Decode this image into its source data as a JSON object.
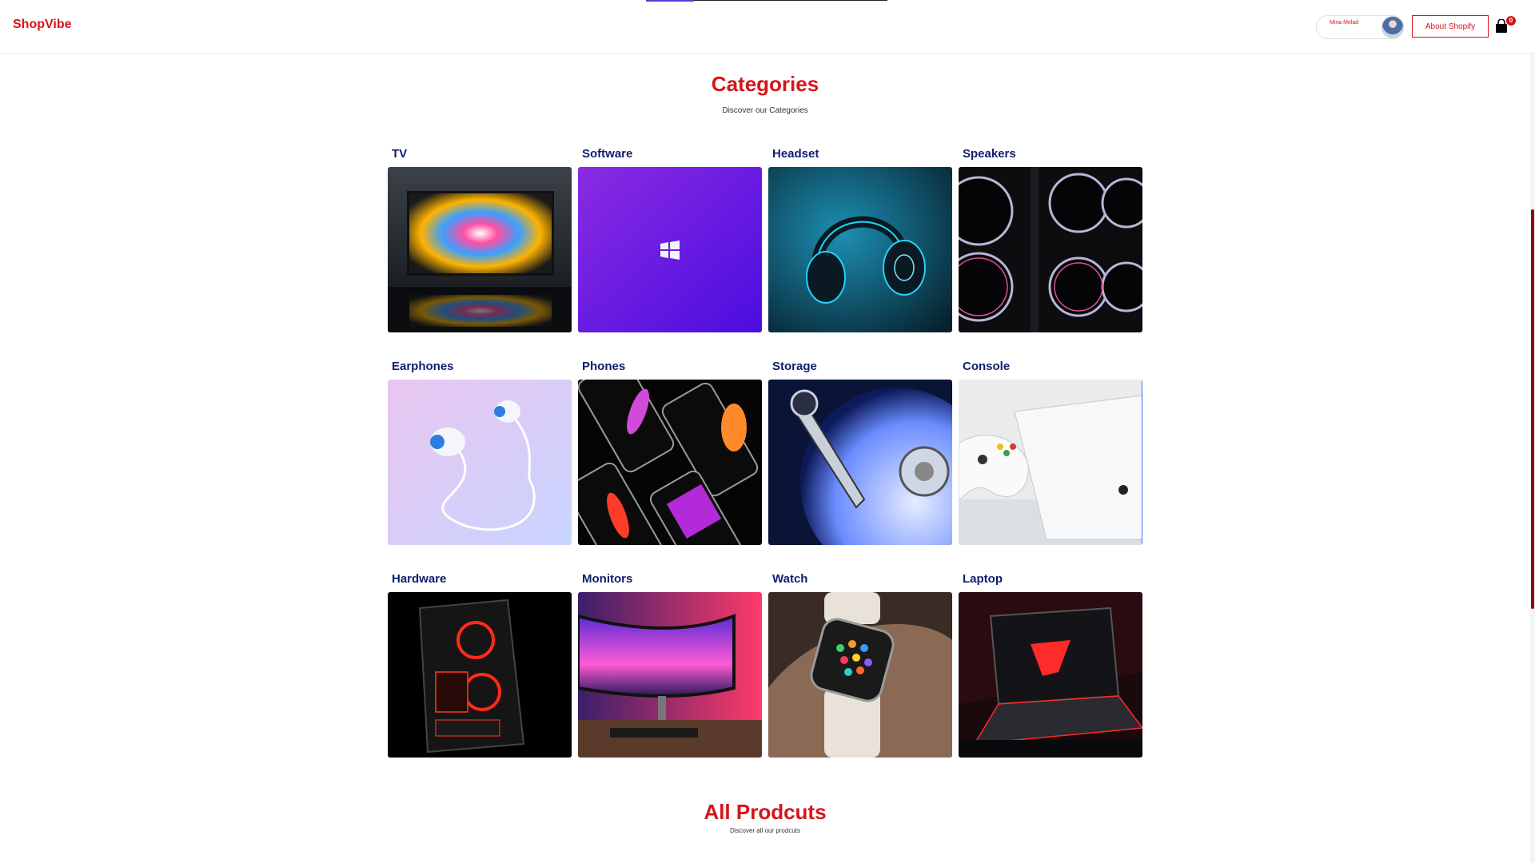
{
  "header": {
    "brand": "ShopVibe",
    "user_name": "Mina Melad",
    "about_label": "About Shopify",
    "cart_count": "0",
    "cart_icon": "shopping-bag-icon"
  },
  "categories_section": {
    "title": "Categories",
    "subtitle": "Discover our Categories",
    "items": [
      {
        "label": "TV"
      },
      {
        "label": "Software"
      },
      {
        "label": "Headset"
      },
      {
        "label": "Speakers"
      },
      {
        "label": "Earphones"
      },
      {
        "label": "Phones"
      },
      {
        "label": "Storage"
      },
      {
        "label": "Console"
      },
      {
        "label": "Hardware"
      },
      {
        "label": "Monitors"
      },
      {
        "label": "Watch"
      },
      {
        "label": "Laptop"
      }
    ]
  },
  "products_section": {
    "title": "All Prodcuts",
    "subtitle": "Discover all our prodcuts"
  },
  "colors": {
    "brand_red": "#d6141a",
    "label_navy": "#0f1e6e"
  }
}
